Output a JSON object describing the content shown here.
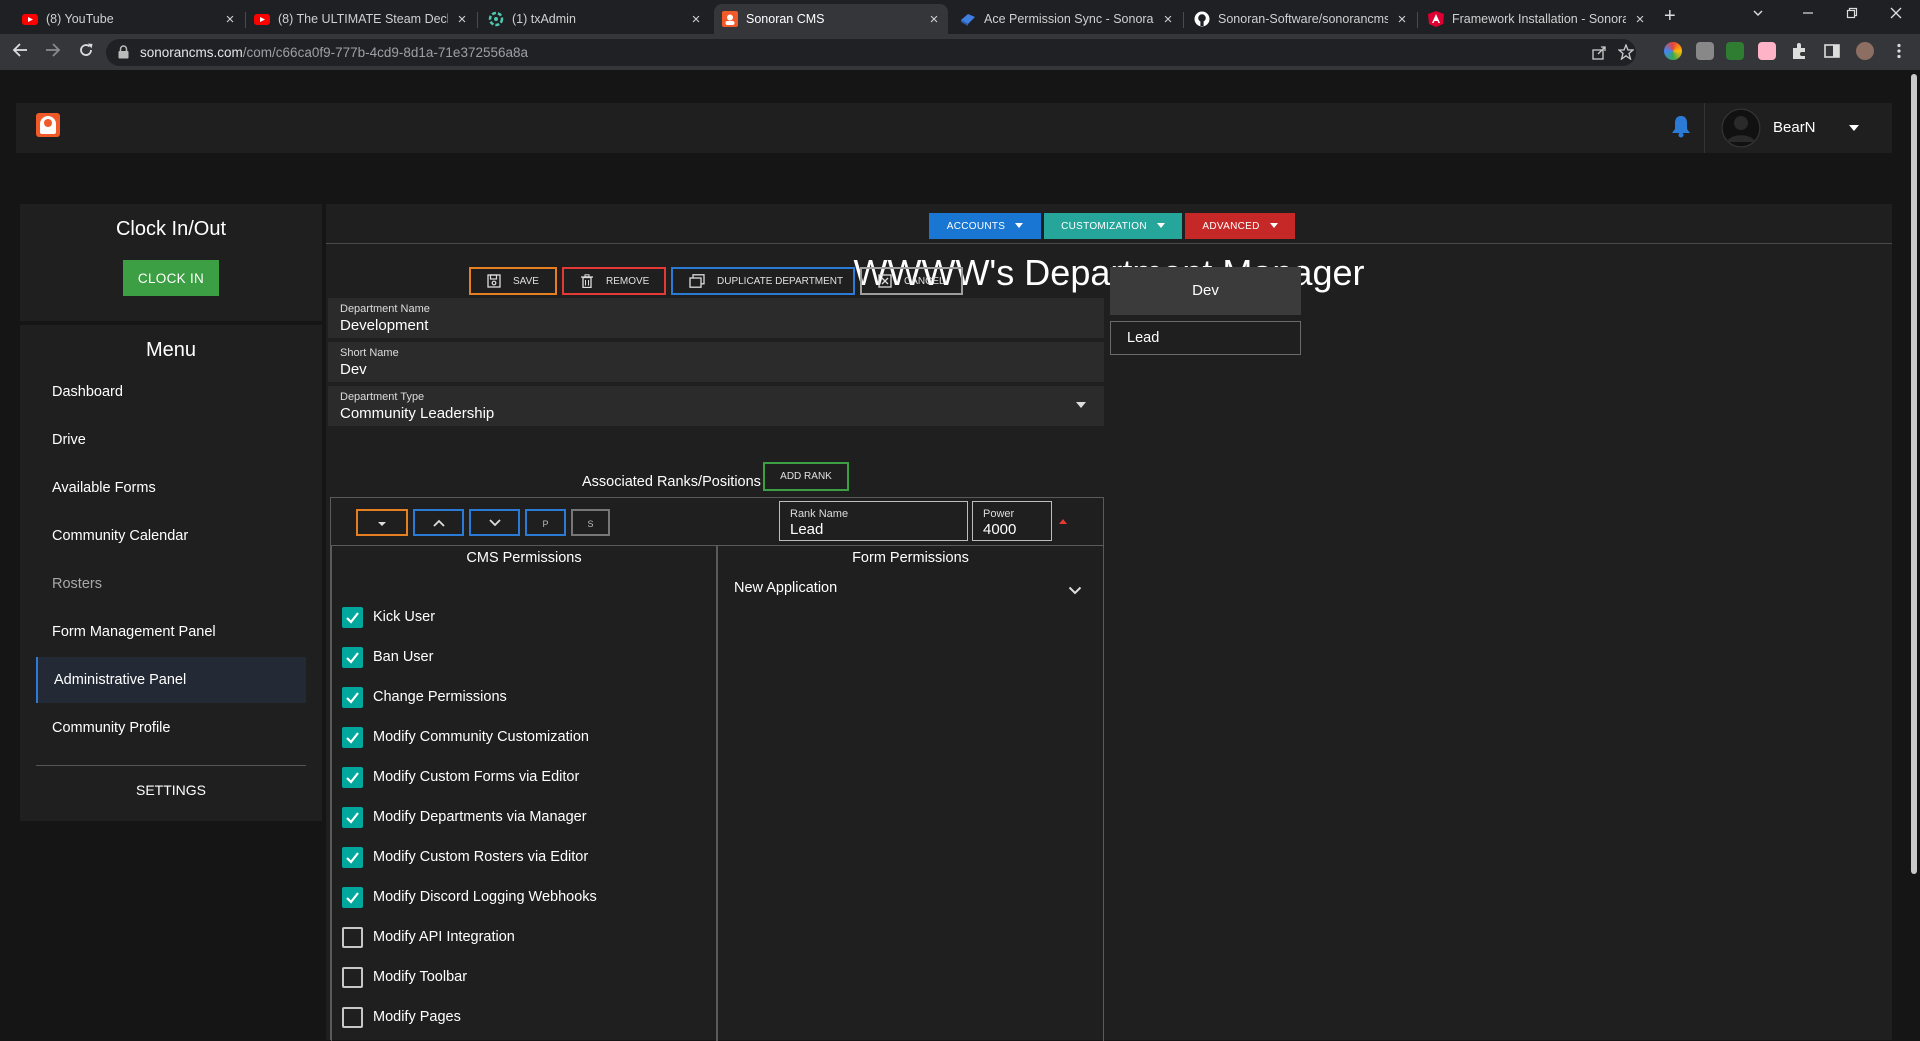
{
  "browser": {
    "tabs": [
      {
        "title": "(8) YouTube",
        "favicon": "youtube-icon"
      },
      {
        "title": "(8) The ULTIMATE Steam Deck -",
        "favicon": "youtube-icon"
      },
      {
        "title": "(1) txAdmin",
        "favicon": "txadmin-icon"
      },
      {
        "title": "Sonoran CMS",
        "favicon": "sonoran-icon"
      },
      {
        "title": "Ace Permission Sync - Sonoran (",
        "favicon": "ace-icon"
      },
      {
        "title": "Sonoran-Software/sonorancms_",
        "favicon": "github-icon"
      },
      {
        "title": "Framework Installation - Sonora",
        "favicon": "framework-icon"
      }
    ],
    "active_tab": 3,
    "url_domain": "sonorancms.com",
    "url_path": "/com/c66ca0f9-777b-4cd9-8d1a-71e372556a8a"
  },
  "header": {
    "username": "BearN"
  },
  "clock": {
    "title": "Clock In/Out",
    "button": "CLOCK IN"
  },
  "menu": {
    "title": "Menu",
    "items": [
      {
        "label": "Dashboard"
      },
      {
        "label": "Drive"
      },
      {
        "label": "Available Forms"
      },
      {
        "label": "Community Calendar"
      },
      {
        "label": "Rosters"
      },
      {
        "label": "Form Management Panel"
      },
      {
        "label": "Administrative Panel"
      },
      {
        "label": "Community Profile"
      }
    ],
    "settings": "SETTINGS"
  },
  "categories": {
    "accounts": "ACCOUNTS",
    "customization": "CUSTOMIZATION",
    "advanced": "ADVANCED"
  },
  "page_title": "WWWW's Department Manager",
  "actions": {
    "save": "SAVE",
    "remove": "REMOVE",
    "duplicate": "DUPLICATE DEPARTMENT",
    "cancel": "CANCEL"
  },
  "form": {
    "department_name_label": "Department Name",
    "department_name": "Development",
    "short_name_label": "Short Name",
    "short_name": "Dev",
    "department_type_label": "Department Type",
    "department_type": "Community Leadership"
  },
  "ranks": {
    "heading": "Associated Ranks/Positions",
    "add_rank": "ADD RANK",
    "p_label": "P",
    "s_label": "S",
    "rank_name_label": "Rank Name",
    "rank_name": "Lead",
    "power_label": "Power",
    "power": "4000"
  },
  "cms_permissions": {
    "title": "CMS Permissions",
    "items": [
      {
        "label": "Kick User",
        "checked": true
      },
      {
        "label": "Ban User",
        "checked": true
      },
      {
        "label": "Change Permissions",
        "checked": true
      },
      {
        "label": "Modify Community Customization",
        "checked": true
      },
      {
        "label": "Modify Custom Forms via Editor",
        "checked": true
      },
      {
        "label": "Modify Departments via Manager",
        "checked": true
      },
      {
        "label": "Modify Custom Rosters via Editor",
        "checked": true
      },
      {
        "label": "Modify Discord Logging Webhooks",
        "checked": true
      },
      {
        "label": "Modify API Integration",
        "checked": false
      },
      {
        "label": "Modify Toolbar",
        "checked": false
      },
      {
        "label": "Modify Pages",
        "checked": false
      }
    ]
  },
  "form_permissions": {
    "title": "Form Permissions",
    "item": "New Application"
  },
  "side_list": {
    "department": "Dev",
    "rank": "Lead"
  },
  "colors": {
    "accounts": "#1976d2",
    "customization": "#26a69a",
    "advanced": "#c62828",
    "clock_in": "#3d9f44",
    "checkbox": "#00a79d",
    "bell": "#2b7bd6"
  }
}
